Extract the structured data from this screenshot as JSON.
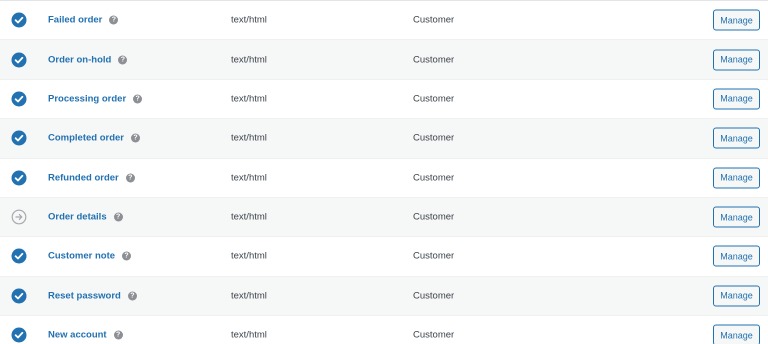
{
  "columns": {
    "status": "",
    "email": "",
    "content_type": "",
    "recipients": "",
    "actions": ""
  },
  "colors": {
    "enabled": "#2271b1",
    "manual": "#a7aaad",
    "link": "#2271b1"
  },
  "rows": [
    {
      "status": "enabled",
      "status_icon": "check-circle-icon",
      "name": "Failed order",
      "help_icon": "help-icon",
      "content_type": "text/html",
      "recipient": "Customer",
      "action": "Manage"
    },
    {
      "status": "enabled",
      "status_icon": "check-circle-icon",
      "name": "Order on-hold",
      "help_icon": "help-icon",
      "content_type": "text/html",
      "recipient": "Customer",
      "action": "Manage"
    },
    {
      "status": "enabled",
      "status_icon": "check-circle-icon",
      "name": "Processing order",
      "help_icon": "help-icon",
      "content_type": "text/html",
      "recipient": "Customer",
      "action": "Manage"
    },
    {
      "status": "enabled",
      "status_icon": "check-circle-icon",
      "name": "Completed order",
      "help_icon": "help-icon",
      "content_type": "text/html",
      "recipient": "Customer",
      "action": "Manage"
    },
    {
      "status": "enabled",
      "status_icon": "check-circle-icon",
      "name": "Refunded order",
      "help_icon": "help-icon",
      "content_type": "text/html",
      "recipient": "Customer",
      "action": "Manage"
    },
    {
      "status": "manual",
      "status_icon": "arrow-right-circle-icon",
      "name": "Order details",
      "help_icon": "help-icon",
      "content_type": "text/html",
      "recipient": "Customer",
      "action": "Manage"
    },
    {
      "status": "enabled",
      "status_icon": "check-circle-icon",
      "name": "Customer note",
      "help_icon": "help-icon",
      "content_type": "text/html",
      "recipient": "Customer",
      "action": "Manage"
    },
    {
      "status": "enabled",
      "status_icon": "check-circle-icon",
      "name": "Reset password",
      "help_icon": "help-icon",
      "content_type": "text/html",
      "recipient": "Customer",
      "action": "Manage"
    },
    {
      "status": "enabled",
      "status_icon": "check-circle-icon",
      "name": "New account",
      "help_icon": "help-icon",
      "content_type": "text/html",
      "recipient": "Customer",
      "action": "Manage"
    }
  ]
}
